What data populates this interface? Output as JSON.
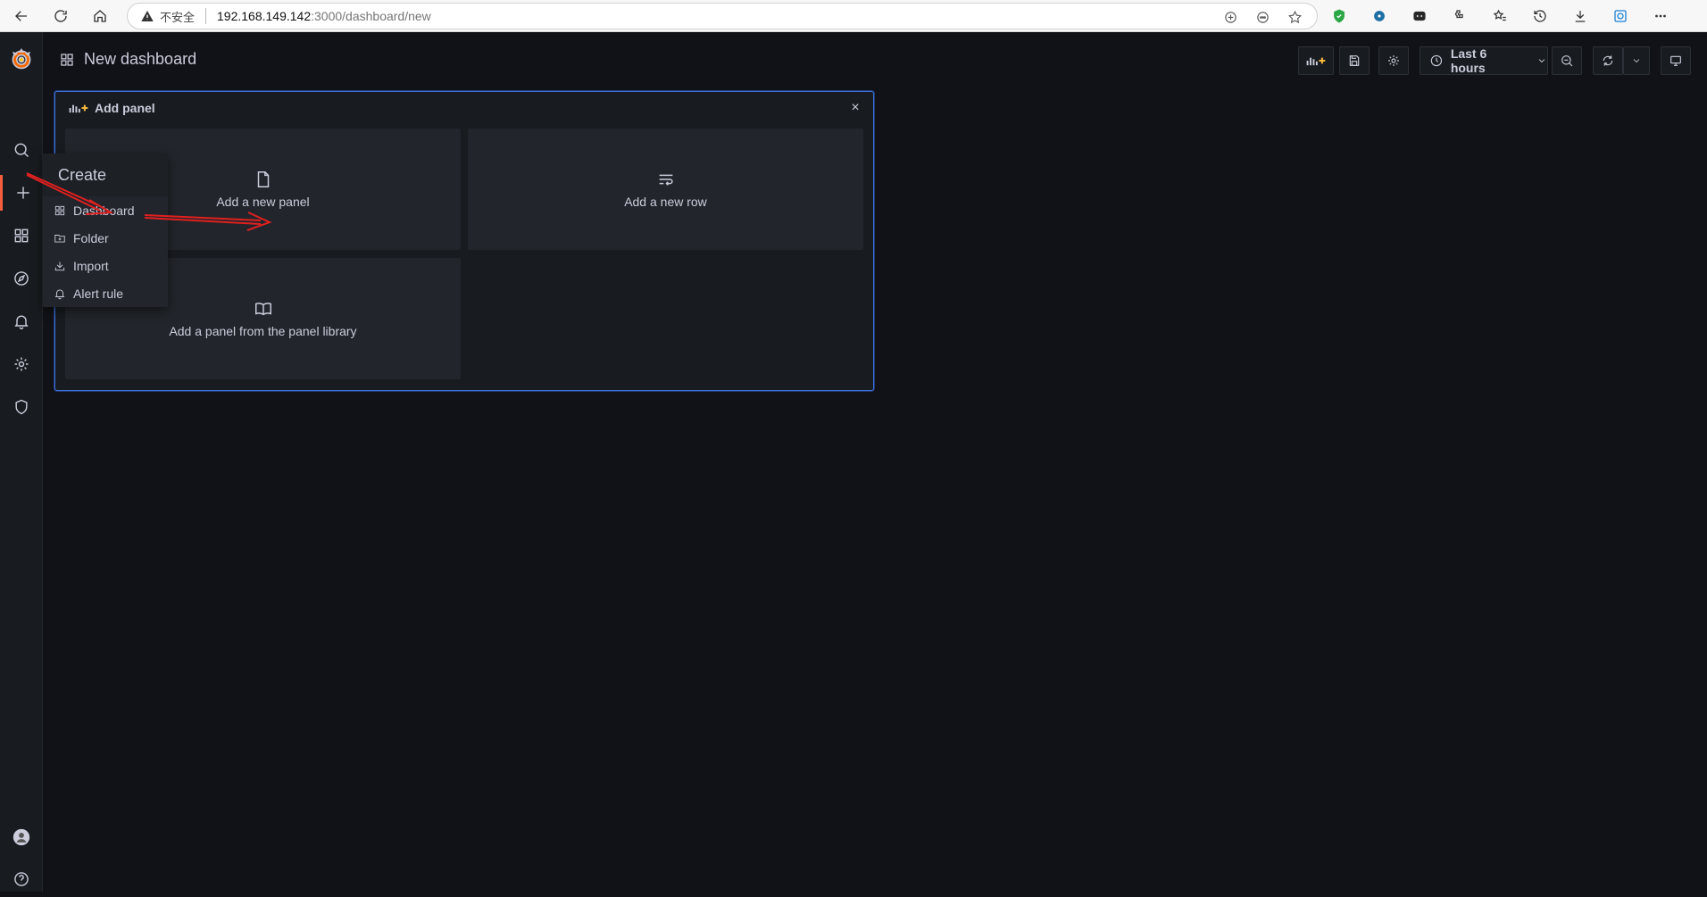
{
  "browser": {
    "insecure_label": "不安全",
    "url_host": "192.168.149.142",
    "url_path": ":3000/dashboard/new"
  },
  "sidebar": {
    "items": [
      "search",
      "create",
      "dashboards",
      "explore",
      "alerting",
      "configuration",
      "server-admin",
      "profile",
      "help"
    ]
  },
  "topbar": {
    "title": "New dashboard",
    "time_range": "Last 6 hours"
  },
  "add_panel": {
    "header": "Add panel",
    "close": "×",
    "tiles": {
      "new_panel": "Add a new panel",
      "new_row": "Add a new row",
      "library": "Add a panel from the panel library"
    }
  },
  "create_menu": {
    "title": "Create",
    "items": {
      "dashboard": "Dashboard",
      "folder": "Folder",
      "import": "Import",
      "alert_rule": "Alert rule"
    }
  },
  "colors": {
    "accent": "#f55f3e",
    "panel_border": "#3d71d9",
    "annotation_arrow": "#e02020"
  }
}
